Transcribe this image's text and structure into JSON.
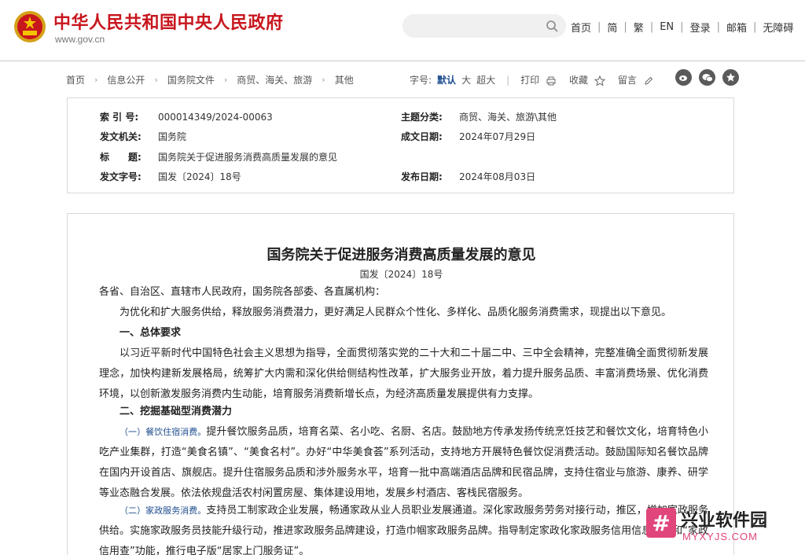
{
  "header": {
    "site_title": "中华人民共和国中央人民政府",
    "site_url": "www.gov.cn",
    "nav": [
      "首页",
      "简",
      "繁",
      "EN",
      "登录",
      "邮箱",
      "无障碍"
    ],
    "search_placeholder": "",
    "brand_color": "#c8161d"
  },
  "breadcrumb": {
    "items": [
      "首页",
      "信息公开",
      "国务院文件",
      "商贸、海关、旅游",
      "其他"
    ],
    "font_size_label": "字号:",
    "font_sizes": [
      "默认",
      "大",
      "超大"
    ],
    "print_label": "打印",
    "collect_label": "收藏",
    "comment_label": "留言",
    "share_icons": [
      "weibo-icon",
      "wechat-icon",
      "star-icon"
    ]
  },
  "info": {
    "index_label": "索 引 号:",
    "index_value": "000014349/2024-00063",
    "topic_label": "主题分类:",
    "topic_value": "商贸、海关、旅游\\其他",
    "issuer_label": "发文机关:",
    "issuer_value": "国务院",
    "date_label": "成文日期:",
    "date_value": "2024年07月29日",
    "title_label": "标　　题:",
    "title_value": "国务院关于促进服务消费高质量发展的意见",
    "docno_label": "发文字号:",
    "docno_value": "国发〔2024〕18号",
    "pub_label": "发布日期:",
    "pub_value": "2024年08月03日"
  },
  "article": {
    "title": "国务院关于促进服务消费高质量发展的意见",
    "docno": "国发〔2024〕18号",
    "salutation": "各省、自治区、直辖市人民政府，国务院各部委、各直属机构：",
    "intro": "为优化和扩大服务供给，释放服务消费潜力，更好满足人民群众个性化、多样化、品质化服务消费需求，现提出以下意见。",
    "sec1": "一、总体要求",
    "p1": "以习近平新时代中国特色社会主义思想为指导，全面贯彻落实党的二十大和二十届二中、三中全会精神，完整准确全面贯彻新发展理念，加快构建新发展格局，统筹扩大内需和深化供给侧结构性改革，扩大服务业开放，着力提升服务品质、丰富消费场景、优化消费环境，以创新激发服务消费内生动能，培育服务消费新增长点，为经济高质量发展提供有力支撑。",
    "sec2": "二、挖掘基础型消费潜力",
    "p2_tag": "（一）餐饮住宿消费。",
    "p2": "提升餐饮服务品质，培育名菜、名小吃、名厨、名店。鼓励地方传承发扬传统烹饪技艺和餐饮文化，培育特色小吃产业集群，打造“美食名镇”、“美食名村”。办好“中华美食荟”系列活动，支持地方开展特色餐饮促消费活动。鼓励国际知名餐饮品牌在国内开设首店、旗舰店。提升住宿服务品质和涉外服务水平，培育一批中高端酒店品牌和民宿品牌，支持住宿业与旅游、康养、研学等业态融合发展。依法依规盘活农村闲置房屋、集体建设用地，发展乡村酒店、客栈民宿服务。",
    "p3_tag": "（二）家政服务消费。",
    "p3": "支持员工制家政企业发展，畅通家政从业人员职业发展通道。深化家政服务劳务对接行动，推区，增加家政服务供给。实施家政服务员技能升级行动，推进家政服务品牌建设，打造巾帼家政服务品牌。指导制定家政化家政服务信用信息平台和“家政信用查”功能，推行电子版“居家上门服务证”。"
  },
  "watermark": {
    "logo_glyph": "#",
    "name": "兴业软件园",
    "url": "MYXYJS.COM"
  }
}
